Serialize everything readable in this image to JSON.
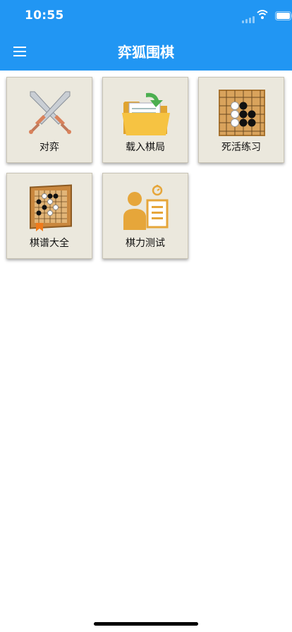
{
  "status": {
    "time": "10:55"
  },
  "header": {
    "title": "弈狐围棋"
  },
  "tiles": [
    {
      "label": "对弈",
      "icon": "crossed-swords-icon"
    },
    {
      "label": "载入棋局",
      "icon": "folder-icon"
    },
    {
      "label": "死活练习",
      "icon": "go-board-stones-icon"
    },
    {
      "label": "棋谱大全",
      "icon": "go-book-icon"
    },
    {
      "label": "棋力测试",
      "icon": "person-test-icon"
    }
  ],
  "colors": {
    "appbar": "#2196f3",
    "tile_bg": "#ebe8dd"
  }
}
